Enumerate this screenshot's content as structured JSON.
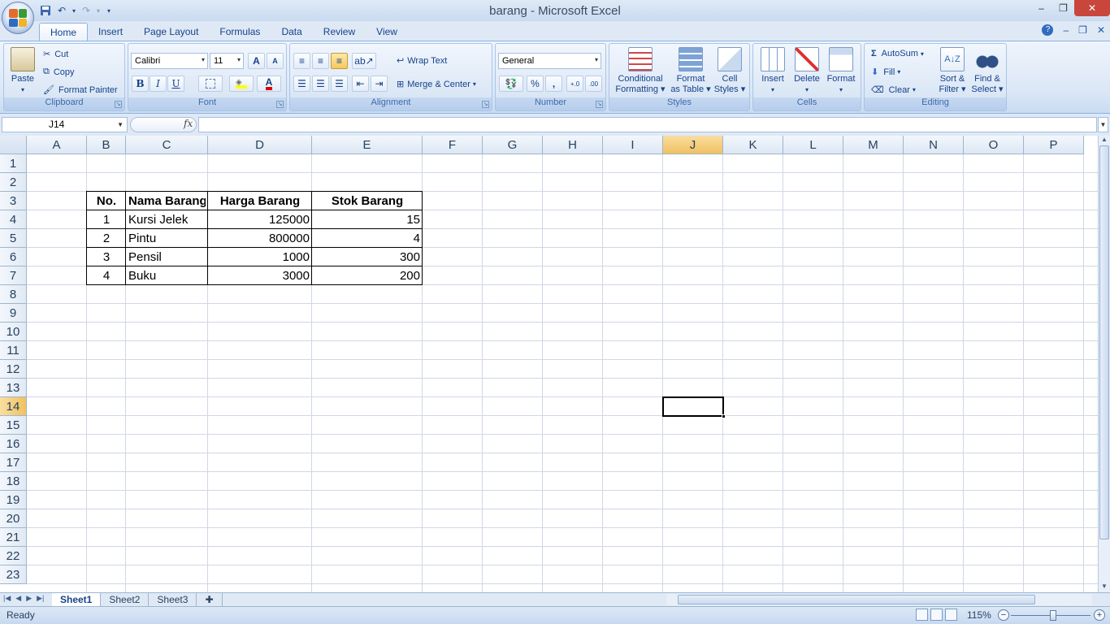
{
  "window": {
    "title": "barang - Microsoft Excel",
    "minimize": "–",
    "maximize": "❐",
    "close": "✕"
  },
  "tabs": [
    "Home",
    "Insert",
    "Page Layout",
    "Formulas",
    "Data",
    "Review",
    "View"
  ],
  "tabs_right": {
    "help": "?",
    "min": "–",
    "restore": "❐",
    "close": "✕"
  },
  "ribbon": {
    "clipboard": {
      "title": "Clipboard",
      "paste": "Paste",
      "cut": "Cut",
      "copy": "Copy",
      "format_painter": "Format Painter"
    },
    "font": {
      "title": "Font",
      "name": "Calibri",
      "size": "11",
      "grow": "A",
      "shrink": "A",
      "bold": "B",
      "italic": "I",
      "underline": "U",
      "font_color": "A"
    },
    "alignment": {
      "title": "Alignment",
      "wrap_text": "Wrap Text",
      "merge_center": "Merge & Center"
    },
    "number": {
      "title": "Number",
      "format": "General",
      "percent": "%",
      "comma": ",",
      "inc_dec": "+.0",
      "dec_dec": ".00"
    },
    "styles": {
      "title": "Styles",
      "conditional_1": "Conditional",
      "conditional_2": "Formatting",
      "format_table_1": "Format",
      "format_table_2": "as Table",
      "cell_styles_1": "Cell",
      "cell_styles_2": "Styles"
    },
    "cells": {
      "title": "Cells",
      "insert": "Insert",
      "delete": "Delete",
      "format": "Format"
    },
    "editing": {
      "title": "Editing",
      "autosum": "AutoSum",
      "fill": "Fill",
      "clear": "Clear",
      "sort_1": "Sort &",
      "sort_2": "Filter",
      "find_1": "Find &",
      "find_2": "Select"
    }
  },
  "formula_bar": {
    "name_box": "J14",
    "fx": "fx",
    "formula": ""
  },
  "columns": [
    "A",
    "B",
    "C",
    "D",
    "E",
    "F",
    "G",
    "H",
    "I",
    "J",
    "K",
    "L",
    "M",
    "N",
    "O",
    "P"
  ],
  "rows": [
    "1",
    "2",
    "3",
    "4",
    "5",
    "6",
    "7",
    "8",
    "9",
    "10",
    "11",
    "12",
    "13",
    "14",
    "15",
    "16",
    "17",
    "18",
    "19",
    "20",
    "21",
    "22",
    "23"
  ],
  "selected_cell": "J14",
  "table": {
    "headers": [
      "No.",
      "Nama Barang",
      "Harga Barang",
      "Stok Barang"
    ],
    "rows": [
      [
        "1",
        "Kursi Jelek",
        "125000",
        "15"
      ],
      [
        "2",
        "Pintu",
        "800000",
        "4"
      ],
      [
        "3",
        "Pensil",
        "1000",
        "300"
      ],
      [
        "4",
        "Buku",
        "3000",
        "200"
      ]
    ]
  },
  "sheets": [
    "Sheet1",
    "Sheet2",
    "Sheet3"
  ],
  "active_sheet": "Sheet1",
  "status": {
    "text": "Ready",
    "zoom": "115%"
  }
}
